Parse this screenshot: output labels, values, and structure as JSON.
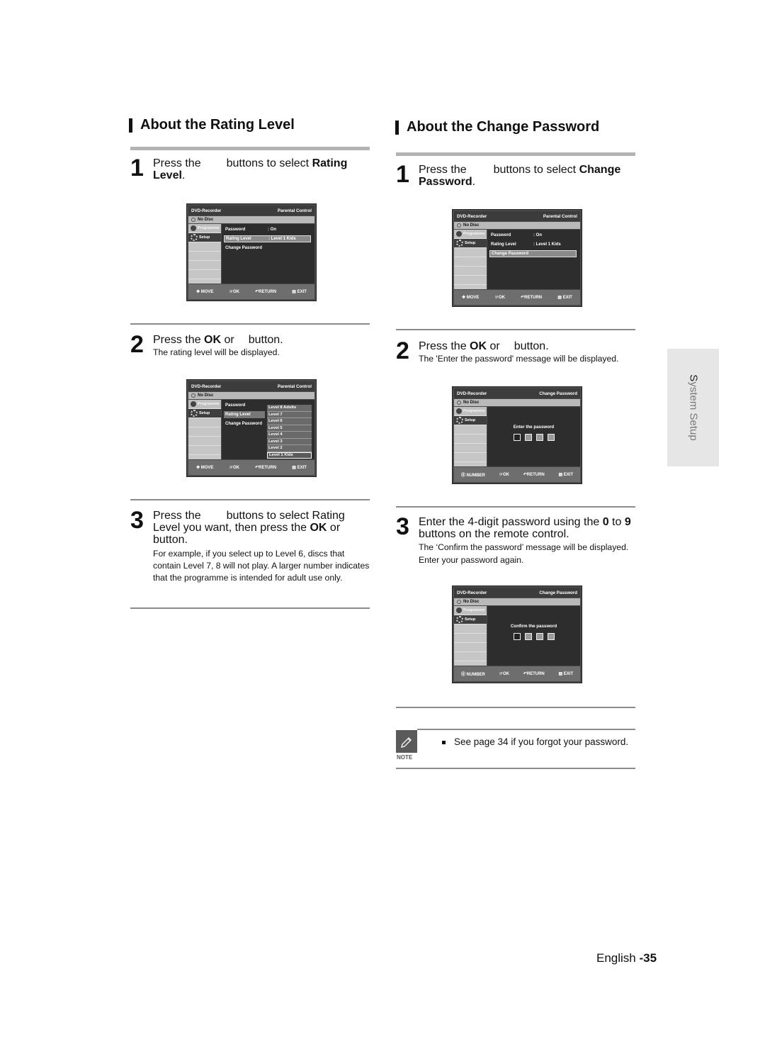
{
  "left": {
    "title": "About the Rating Level",
    "step1": {
      "num": "1",
      "pre": "Press the",
      "post": "buttons to select ",
      "bold": "Rating",
      "bold2": "Level",
      "end": "."
    },
    "step2": {
      "num": "2",
      "pre": "Press the ",
      "bold": "OK",
      "post": " or",
      "post2": "button.",
      "sub": "The rating level will be displayed."
    },
    "step3": {
      "num": "3",
      "line1_pre": "Press the",
      "line1_post": "buttons to select Rating",
      "line2_pre": "Level you want, then press the ",
      "line2_bold": "OK",
      "line2_post": " or",
      "line3": "button.",
      "sub": "For example, if you select up to Level 6, discs that contain Level 7, 8 will not play. A larger number indicates that the programme is intended for adult use only."
    },
    "osd1": {
      "app": "DVD-Recorder",
      "section": "Parental Control",
      "disc": "No Disc",
      "side": [
        "Programme",
        "Setup"
      ],
      "rows": [
        {
          "label": "Password",
          "value": ": On"
        },
        {
          "label": "Rating Level",
          "value": ": Level 1 Kids"
        },
        {
          "label": "Change Password",
          "value": ""
        }
      ],
      "footer": [
        "MOVE",
        "OK",
        "RETURN",
        "EXIT"
      ]
    },
    "osd2": {
      "app": "DVD-Recorder",
      "section": "Parental Control",
      "disc": "No Disc",
      "side": [
        "Programme",
        "Setup"
      ],
      "rows": [
        {
          "label": "Password"
        },
        {
          "label": "Rating Level"
        },
        {
          "label": "Change Password"
        }
      ],
      "levels": [
        "Level 8 Adults",
        "Level 7",
        "Level 6",
        "Level 5",
        "Level 4",
        "Level 3",
        "Level 2",
        "Level 1 Kids"
      ],
      "footer": [
        "MOVE",
        "OK",
        "RETURN",
        "EXIT"
      ]
    }
  },
  "right": {
    "title": "About the Change Password",
    "step1": {
      "num": "1",
      "pre": "Press the",
      "post": "buttons to select ",
      "bold": "Change",
      "bold2": "Password",
      "end": "."
    },
    "step2": {
      "num": "2",
      "pre": "Press the ",
      "bold": "OK",
      "post": " or",
      "post2": "button.",
      "sub": "The 'Enter the password' message will be displayed."
    },
    "step3": {
      "num": "3",
      "line1_pre": "Enter the 4-digit password using the ",
      "b1": "0",
      "mid": " to ",
      "b2": "9",
      "line2": "buttons on the remote control.",
      "sub1": "The ‘Confirm the password’ message will be displayed.",
      "sub2": "Enter your password again."
    },
    "osd1": {
      "app": "DVD-Recorder",
      "section": "Parental Control",
      "disc": "No Disc",
      "side": [
        "Programme",
        "Setup"
      ],
      "rows": [
        {
          "label": "Password",
          "value": ": On"
        },
        {
          "label": "Rating Level",
          "value": ": Level 1 Kids"
        },
        {
          "label": "Change Password",
          "value": ""
        }
      ],
      "footer": [
        "MOVE",
        "OK",
        "RETURN",
        "EXIT"
      ]
    },
    "osd2": {
      "app": "DVD-Recorder",
      "section": "Change Password",
      "disc": "No Disc",
      "side": [
        "Programme",
        "Setup"
      ],
      "prompt": "Enter the password",
      "footer": [
        "NUMBER",
        "OK",
        "RETURN",
        "EXIT"
      ]
    },
    "osd3": {
      "app": "DVD-Recorder",
      "section": "Change Password",
      "disc": "No Disc",
      "side": [
        "Programme",
        "Setup"
      ],
      "prompt": "Confirm the password",
      "footer": [
        "NUMBER",
        "OK",
        "RETURN",
        "EXIT"
      ]
    },
    "note": {
      "label": "NOTE",
      "text": "See page 34 if you forgot your password."
    }
  },
  "side_tab": {
    "word1": "S",
    "rest": "ystem Setup"
  },
  "footer": {
    "lang": "English ",
    "page": "-35"
  }
}
